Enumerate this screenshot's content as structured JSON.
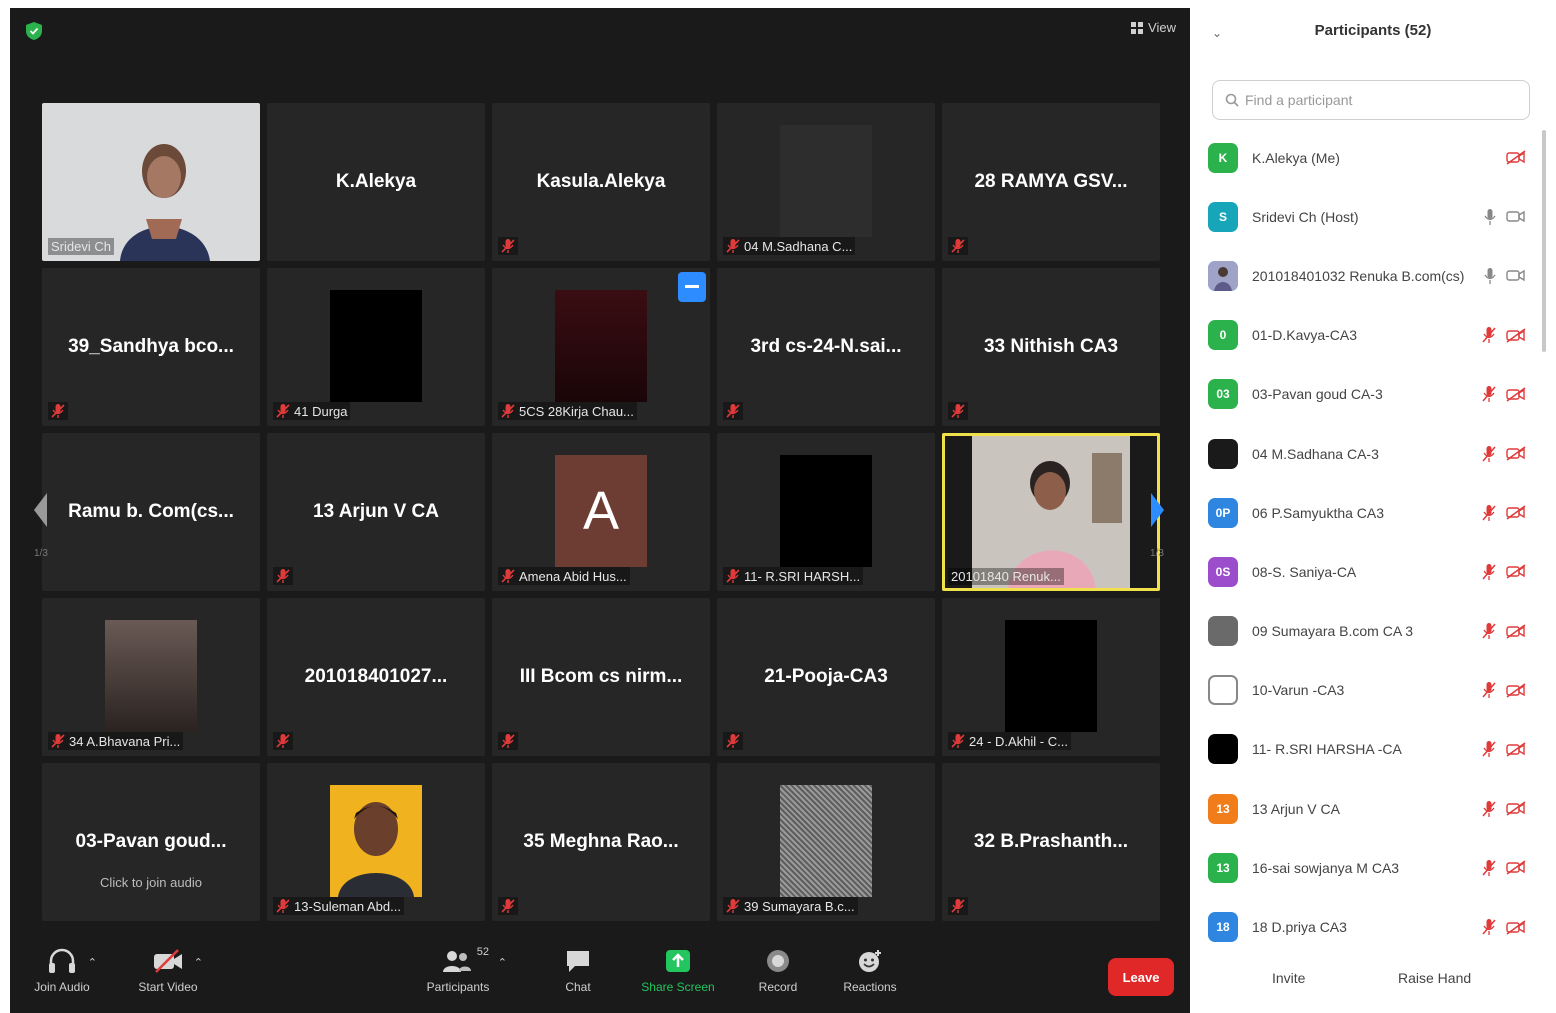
{
  "meeting": {
    "view_label": "View",
    "tiles": [
      {
        "type": "video",
        "image": "woman-at-wall",
        "label": "Sridevi Ch"
      },
      {
        "type": "name",
        "name": "K.Alekya",
        "muted": false
      },
      {
        "type": "name",
        "name": "Kasula.Alekya",
        "muted": true
      },
      {
        "type": "video",
        "image": "dark",
        "label": "04 M.Sadhana C..."
      },
      {
        "type": "name",
        "name": "28 RAMYA GSV...",
        "muted": true
      },
      {
        "type": "name",
        "name": "39_Sandhya bco...",
        "muted": true
      },
      {
        "type": "video",
        "image": "black",
        "label": "41 Durga"
      },
      {
        "type": "video",
        "image": "maroon",
        "label": "5CS 28Kirja Chau...",
        "badge": true
      },
      {
        "type": "name",
        "name": "3rd cs-24-N.sai...",
        "muted": true
      },
      {
        "type": "name",
        "name": "33 Nithish CA3",
        "muted": true
      },
      {
        "type": "name",
        "name": "Ramu b. Com(cs...",
        "muted": false
      },
      {
        "type": "name",
        "name": "13 Arjun V CA",
        "muted": true
      },
      {
        "type": "avatar",
        "letter": "A",
        "label": "Amena Abid Hus..."
      },
      {
        "type": "video",
        "image": "black",
        "label": "11- R.SRI HARSH..."
      },
      {
        "type": "video",
        "image": "girl-speaking",
        "label": "20101840 Renuk...",
        "active": true
      },
      {
        "type": "video",
        "image": "blurred",
        "label": "34 A.Bhavana Pri..."
      },
      {
        "type": "name",
        "name": "201018401027...",
        "muted": true
      },
      {
        "type": "name",
        "name": "III Bcom cs nirm...",
        "muted": true
      },
      {
        "type": "name",
        "name": "21-Pooja-CA3",
        "muted": true
      },
      {
        "type": "video",
        "image": "black",
        "label": "24 - D.Akhil - C..."
      },
      {
        "type": "name",
        "name": "03-Pavan goud...",
        "muted": false,
        "sub": "Click to join audio"
      },
      {
        "type": "video",
        "image": "man-portrait",
        "label": "13-Suleman Abd..."
      },
      {
        "type": "name",
        "name": "35 Meghna Rao...",
        "muted": true
      },
      {
        "type": "video",
        "image": "noise",
        "label": "39 Sumayara B.c..."
      },
      {
        "type": "name",
        "name": "32 B.Prashanth...",
        "muted": true
      }
    ],
    "page_left": "1/3",
    "page_right": "1/3",
    "toolbar": {
      "join_audio": "Join Audio",
      "start_video": "Start Video",
      "participants": "Participants",
      "participant_count": "52",
      "chat": "Chat",
      "share_screen": "Share Screen",
      "record": "Record",
      "reactions": "Reactions",
      "leave": "Leave"
    },
    "colors": {
      "share": "#22c55e",
      "leave": "#e02828",
      "active_border": "#f0e04a",
      "muted": "#e03a3a"
    }
  },
  "panel": {
    "title": "Participants (52)",
    "search_placeholder": "Find a participant",
    "participants": [
      {
        "initials": "K",
        "color": "#2bb24c",
        "name": "K.Alekya (Me)",
        "audio": "none",
        "video": "off-red"
      },
      {
        "initials": "S",
        "color": "#16a5b9",
        "name": "Sridevi Ch (Host)",
        "audio": "on",
        "video": "on"
      },
      {
        "initials": "",
        "color": "#8a8ad0",
        "name": "201018401032 Renuka B.com(cs)",
        "audio": "on",
        "video": "on",
        "photo": true
      },
      {
        "initials": "0",
        "color": "#2bb24c",
        "name": "01-D.Kavya-CA3",
        "audio": "muted",
        "video": "off"
      },
      {
        "initials": "03",
        "color": "#2bb24c",
        "name": "03-Pavan goud CA-3",
        "audio": "muted",
        "video": "off"
      },
      {
        "initials": "",
        "color": "#1a1a1a",
        "name": "04 M.Sadhana CA-3",
        "audio": "muted",
        "video": "off"
      },
      {
        "initials": "0P",
        "color": "#2f86e0",
        "name": "06 P.Samyuktha CA3",
        "audio": "muted",
        "video": "off"
      },
      {
        "initials": "0S",
        "color": "#9b4dcc",
        "name": "08-S. Saniya-CA",
        "audio": "muted",
        "video": "off"
      },
      {
        "initials": "",
        "color": "#6a6a6a",
        "name": "09 Sumayara B.com CA 3",
        "audio": "muted",
        "video": "off"
      },
      {
        "initials": "",
        "color": "#ffffff",
        "name": "10-Varun -CA3",
        "audio": "muted",
        "video": "off",
        "outline": true
      },
      {
        "initials": "",
        "color": "#000000",
        "name": "11- R.SRI HARSHA -CA",
        "audio": "muted",
        "video": "off"
      },
      {
        "initials": "13",
        "color": "#f07d1a",
        "name": "13 Arjun V CA",
        "audio": "muted",
        "video": "off"
      },
      {
        "initials": "13",
        "color": "#2bb24c",
        "name": "16-sai sowjanya M CA3",
        "audio": "muted",
        "video": "off"
      },
      {
        "initials": "18",
        "color": "#2f86e0",
        "name": "18 D.priya CA3",
        "audio": "muted",
        "video": "off"
      }
    ],
    "footer": {
      "invite": "Invite",
      "raise_hand": "Raise Hand"
    }
  }
}
